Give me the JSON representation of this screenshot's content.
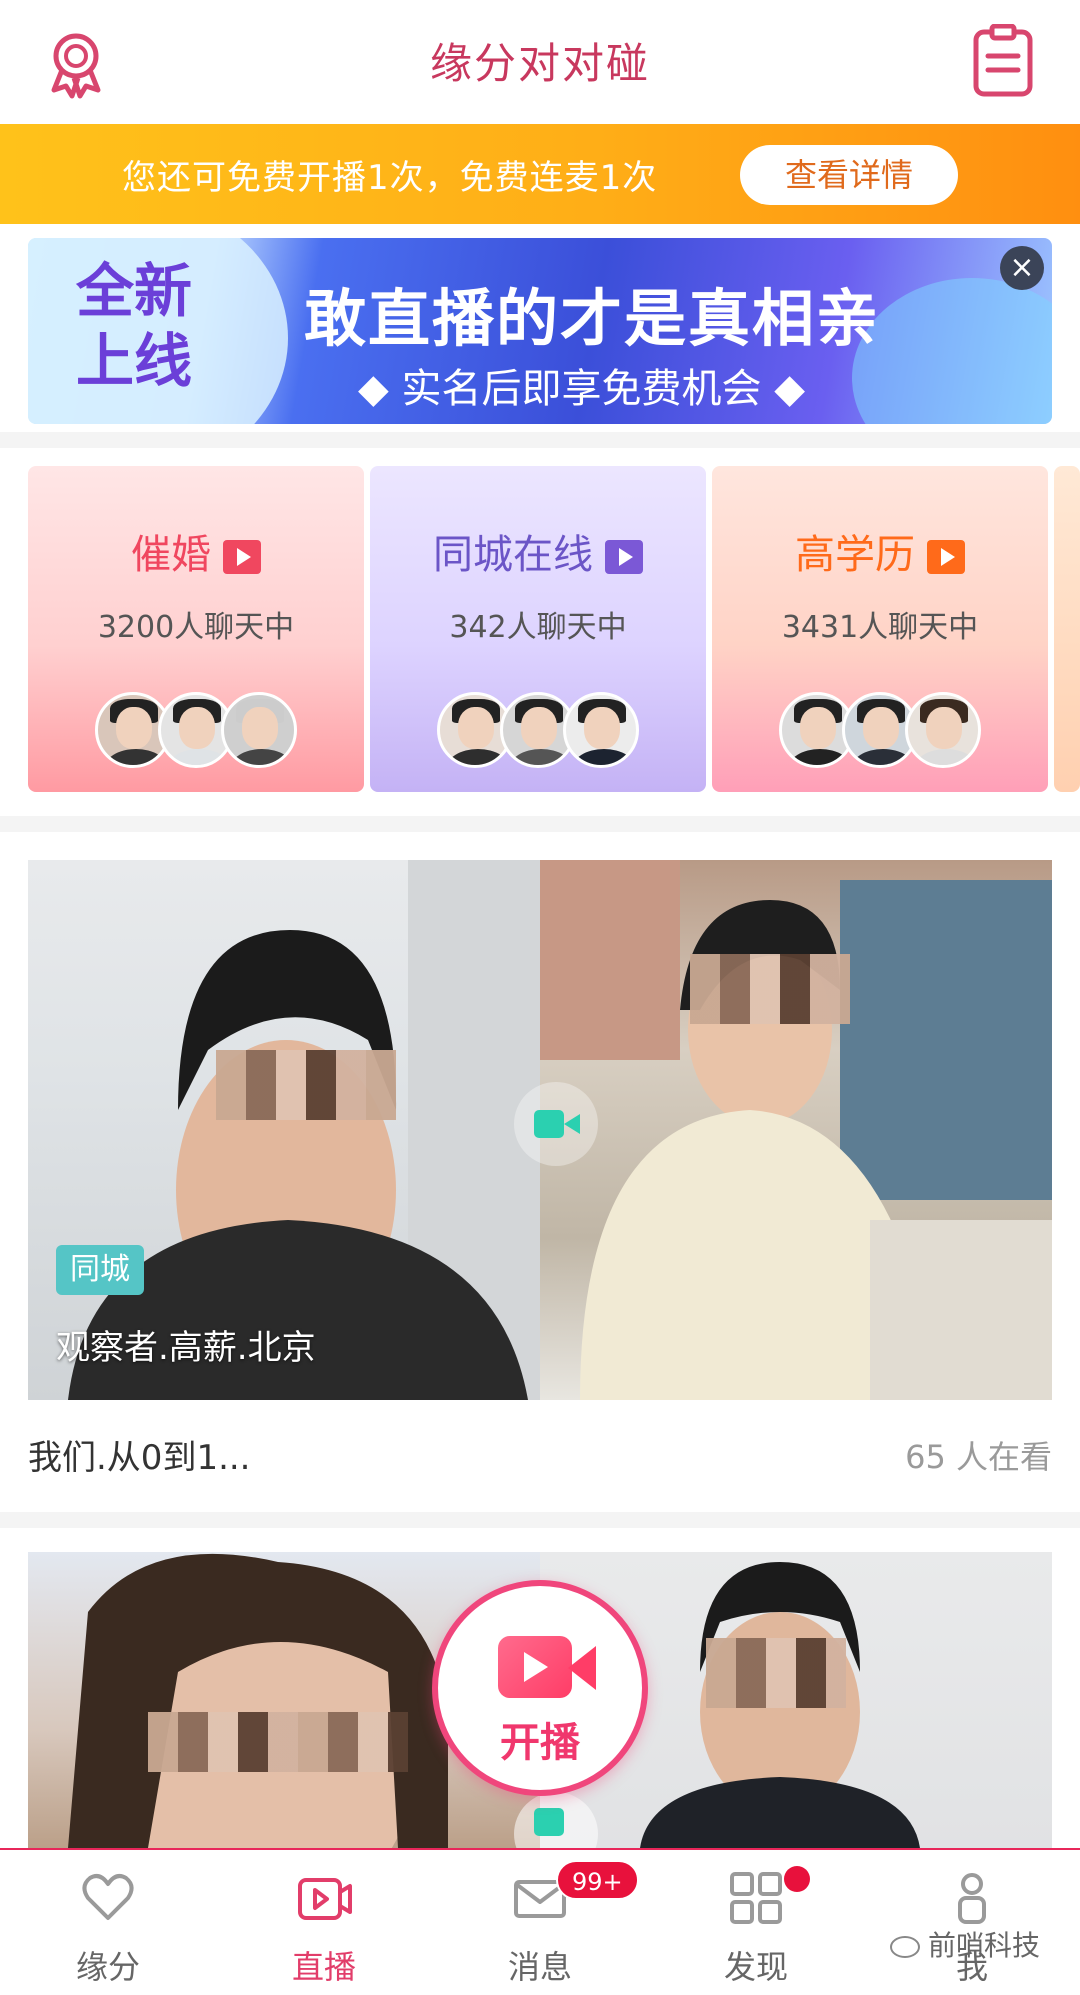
{
  "header": {
    "title": "缘分对对碰"
  },
  "promo": {
    "text": "您还可免费开播1次，免费连麦1次",
    "button": "查看详情"
  },
  "banner": {
    "new_label": "全新上线",
    "headline": "敢直播的才是真相亲",
    "subline": "◆ 实名后即享免费机会 ◆"
  },
  "categories": [
    {
      "name": "催婚",
      "count": "3200人聊天中",
      "accent": "#f0475f"
    },
    {
      "name": "同城在线",
      "count": "342人聊天中",
      "accent": "#7b58d6"
    },
    {
      "name": "高学历",
      "count": "3431人聊天中",
      "accent": "#ff6a1a"
    }
  ],
  "live_cards": [
    {
      "tag": "同城",
      "overlay": "观察者.高薪.北京",
      "caption": "我们.从0到1...",
      "viewers": "65 人在看"
    }
  ],
  "fab": {
    "label": "开播"
  },
  "tabs": [
    {
      "label": "缘分",
      "icon": "heart-icon"
    },
    {
      "label": "直播",
      "icon": "live-video-icon",
      "active": true
    },
    {
      "label": "消息",
      "icon": "mail-icon",
      "badge": "99+"
    },
    {
      "label": "发现",
      "icon": "grid-icon",
      "dot": true
    },
    {
      "label": "我",
      "icon": "person-icon"
    }
  ],
  "watermark": "前哨科技",
  "colors": {
    "brand": "#c8385e",
    "promo_start": "#ffc21a",
    "promo_end": "#ff8f10",
    "tab_active": "#e23d6a",
    "badge": "#e8113c"
  }
}
